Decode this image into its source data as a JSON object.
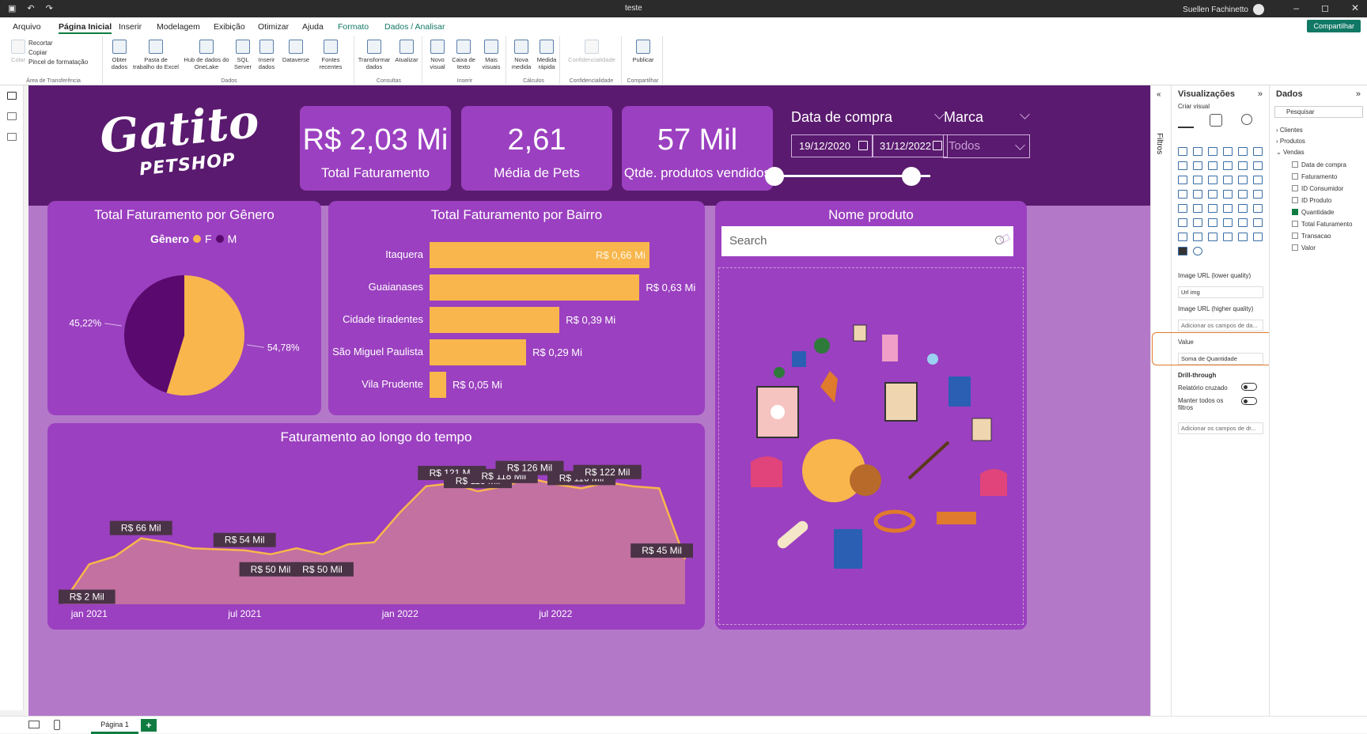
{
  "titlebar": {
    "doc": "teste",
    "user": "Suellen Fachinetto",
    "min": "–",
    "max": "◻",
    "close": "✕"
  },
  "menu": {
    "tabs": [
      "Arquivo",
      "Página Inicial",
      "Inserir",
      "Modelagem",
      "Exibição",
      "Otimizar",
      "Ajuda",
      "Formato",
      "Dados / Analisar"
    ],
    "share": "Compartilhar"
  },
  "ribbon": {
    "clip": {
      "cortar": "Recortar",
      "copiar": "Copiar",
      "pincel": "Pincel de formatação",
      "colar": "Colar",
      "group": "Área de Transferência"
    },
    "dados": [
      "Obter dados",
      "Pasta de trabalho do Excel",
      "Hub de dados do OneLake",
      "SQL Server",
      "Inserir dados",
      "Dataverse",
      "Fontes recentes"
    ],
    "dados_group": "Dados",
    "consultas": [
      "Transformar dados",
      "Atualizar"
    ],
    "consultas_group": "Consultas",
    "inserir": [
      "Novo visual",
      "Caixa de texto",
      "Mais visuais"
    ],
    "inserir_group": "Inserir",
    "calculos": [
      "Nova medida",
      "Medida rápida"
    ],
    "calculos_group": "Cálculos",
    "conf": "Confidencialidade",
    "conf_group": "Confidencialidade",
    "publicar": "Publicar",
    "publicar_group": "Compartilhar"
  },
  "dashboard": {
    "logo_main": "Gatito",
    "logo_sub": "PETSHOP",
    "kpis": [
      {
        "value": "R$ 2,03 Mi",
        "label": "Total Faturamento"
      },
      {
        "value": "2,61",
        "label": "Média de Pets"
      },
      {
        "value": "57 Mil",
        "label": "Qtde. produtos vendidos"
      }
    ],
    "date_slicer": {
      "title": "Data de compra",
      "start": "19/12/2020",
      "end": "31/12/2022"
    },
    "marca_slicer": {
      "title": "Marca",
      "value": "Todos"
    },
    "pie_title": "Total Faturamento por Gênero",
    "legend": {
      "title": "Gênero",
      "f": "F",
      "m": "M"
    },
    "bar_title": "Total Faturamento por Bairro",
    "area_title": "Faturamento ao longo do tempo",
    "nome_title": "Nome produto",
    "search_placeholder": "Search"
  },
  "chart_data": [
    {
      "type": "pie",
      "title": "Total Faturamento por Gênero",
      "categories": [
        "F",
        "M"
      ],
      "values": [
        54.78,
        45.22
      ],
      "labels": [
        "54,78%",
        "45,22%"
      ],
      "colors": {
        "F": "#f8b64c",
        "M": "#5a0a6e"
      }
    },
    {
      "type": "bar",
      "title": "Total Faturamento por Bairro",
      "categories": [
        "Itaquera",
        "Guaianases",
        "Cidade tiradentes",
        "São Miguel Paulista",
        "Vila Prudente"
      ],
      "values": [
        0.66,
        0.63,
        0.39,
        0.29,
        0.05
      ],
      "labels": [
        "R$ 0,66 Mi",
        "R$ 0,63 Mi",
        "R$ 0,39 Mi",
        "R$ 0,29 Mi",
        "R$ 0,05 Mi"
      ],
      "color": "#f8b64c"
    },
    {
      "type": "area",
      "title": "Faturamento ao longo do tempo",
      "x": [
        "2020-12",
        "2021-01",
        "2021-02",
        "2021-03",
        "2021-04",
        "2021-05",
        "2021-06",
        "2021-07",
        "2021-08",
        "2021-09",
        "2021-10",
        "2021-11",
        "2021-12",
        "2022-01",
        "2022-02",
        "2022-03",
        "2022-04",
        "2022-05",
        "2022-06",
        "2022-07",
        "2022-08",
        "2022-09",
        "2022-10",
        "2022-11",
        "2022-12"
      ],
      "values": [
        2,
        40,
        48,
        66,
        62,
        56,
        55,
        54,
        50,
        56,
        50,
        60,
        62,
        92,
        118,
        121,
        113,
        118,
        126,
        120,
        116,
        122,
        118,
        116,
        45
      ],
      "labels": [
        {
          "i": 0,
          "text": "R$ 2 Mil"
        },
        {
          "i": 3,
          "text": "R$ 66 Mil"
        },
        {
          "i": 7,
          "text": "R$ 54 Mil"
        },
        {
          "i": 8,
          "text": "R$ 50 Mil"
        },
        {
          "i": 10,
          "text": "R$ 50 Mil"
        },
        {
          "i": 15,
          "text": "R$ 121 Mil"
        },
        {
          "i": 16,
          "text": "R$ 113 Mil"
        },
        {
          "i": 17,
          "text": "R$ 118 Mil"
        },
        {
          "i": 18,
          "text": "R$ 126 Mil"
        },
        {
          "i": 20,
          "text": "R$ 116 Mil"
        },
        {
          "i": 21,
          "text": "R$ 122 Mil"
        },
        {
          "i": 24,
          "text": "R$ 45 Mil"
        }
      ],
      "xticks": [
        {
          "i": 1,
          "text": "jan 2021"
        },
        {
          "i": 7,
          "text": "jul 2021"
        },
        {
          "i": 13,
          "text": "jan 2022"
        },
        {
          "i": 19,
          "text": "jul 2022"
        }
      ],
      "ylim": [
        0,
        140
      ],
      "colors": {
        "line": "#f8b64c",
        "fill": "#c97a9a"
      }
    }
  ],
  "viz_pane": {
    "title": "Visualizações",
    "subtitle": "Criar visual",
    "well1_label": "Image URL (lower quality)",
    "well1_value": "Url img",
    "well2_label": "Image URL (higher quality)",
    "well2_value": "Adicionar os campos de da...",
    "well3_label": "Value",
    "well3_value": "Soma de Quantidade",
    "drill": "Drill-through",
    "cruzado": "Relatório cruzado",
    "manter": "Manter todos os filtros",
    "well4_value": "Adicionar os campos de dr..."
  },
  "filters_label": "Filtros",
  "data_pane": {
    "title": "Dados",
    "search": "Pesquisar",
    "tables": [
      "Clientes",
      "Produtos",
      "Vendas"
    ],
    "fields": [
      "Data de compra",
      "Faturamento",
      "ID Consumidor",
      "ID Produto",
      "Quantidade",
      "Total Faturamento",
      "Transacao",
      "Valor"
    ]
  },
  "status": {
    "page": "Página 1",
    "add": "+"
  }
}
